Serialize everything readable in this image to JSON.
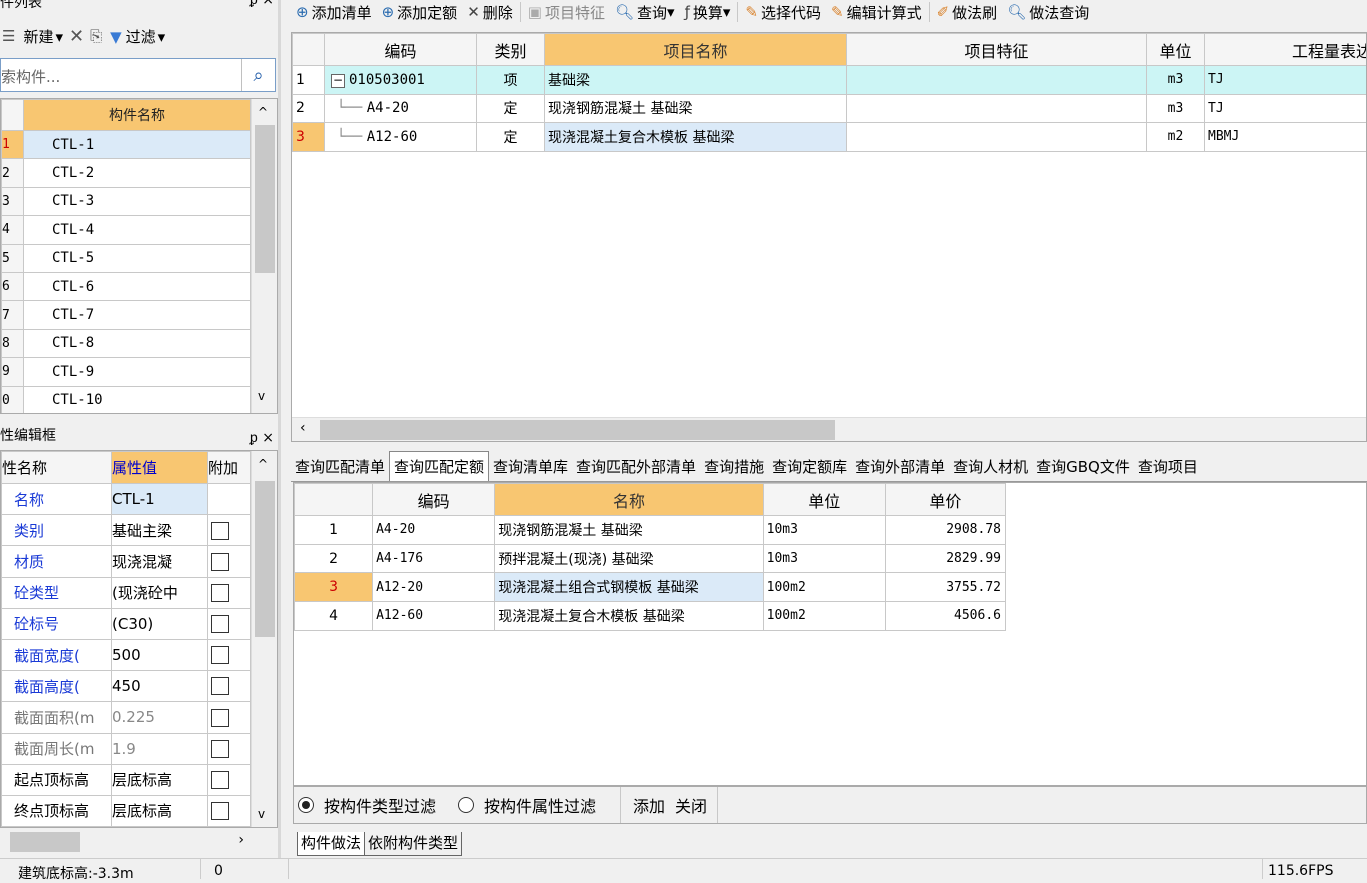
{
  "left_panel": {
    "component_list": {
      "title": "件列表",
      "toolbar": {
        "new_label": "新建",
        "filter_label": "过滤"
      },
      "search_placeholder": "索构件...",
      "header": "构件名称",
      "rows": [
        {
          "num": "1",
          "name": "CTL-1"
        },
        {
          "num": "2",
          "name": "CTL-2"
        },
        {
          "num": "3",
          "name": "CTL-3"
        },
        {
          "num": "4",
          "name": "CTL-4"
        },
        {
          "num": "5",
          "name": "CTL-5"
        },
        {
          "num": "6",
          "name": "CTL-6"
        },
        {
          "num": "7",
          "name": "CTL-7"
        },
        {
          "num": "8",
          "name": "CTL-8"
        },
        {
          "num": "9",
          "name": "CTL-9"
        },
        {
          "num": "0",
          "name": "CTL-10"
        }
      ]
    },
    "property_editor": {
      "title": "性编辑框",
      "headers": [
        "性名称",
        "属性值",
        "附加"
      ],
      "rows": [
        {
          "name": "名称",
          "value": "CTL-1",
          "has_check": false,
          "name_color": "blue"
        },
        {
          "name": "类别",
          "value": "基础主梁",
          "has_check": true,
          "name_color": "blue"
        },
        {
          "name": "材质",
          "value": "现浇混凝",
          "has_check": true,
          "name_color": "blue"
        },
        {
          "name": "砼类型",
          "value": "(现浇砼中",
          "has_check": true,
          "name_color": "blue"
        },
        {
          "name": "砼标号",
          "value": "(C30)",
          "has_check": true,
          "name_color": "blue"
        },
        {
          "name": "截面宽度(",
          "value": "500",
          "has_check": true,
          "name_color": "blue"
        },
        {
          "name": "截面高度(",
          "value": "450",
          "has_check": true,
          "name_color": "blue"
        },
        {
          "name": "截面面积(m",
          "value": "0.225",
          "has_check": true,
          "name_color": "gray"
        },
        {
          "name": "截面周长(m",
          "value": "1.9",
          "has_check": true,
          "name_color": "gray"
        },
        {
          "name": "起点顶标高",
          "value": "层底标高",
          "has_check": true,
          "name_color": "black"
        },
        {
          "name": "终点顶标高",
          "value": "层底标高",
          "has_check": true,
          "name_color": "black"
        }
      ]
    }
  },
  "main_toolbar": {
    "items": [
      "添加清单",
      "添加定额",
      "删除",
      "项目特征",
      "查询",
      "换算",
      "选择代码",
      "编辑计算式",
      "做法刷",
      "做法查询"
    ]
  },
  "upper_grid": {
    "headers": [
      "编码",
      "类别",
      "项目名称",
      "项目特征",
      "单位",
      "工程量表达式"
    ],
    "rows": [
      {
        "num": "1",
        "code": "010503001",
        "type": "项",
        "name": "基础梁",
        "feature": "",
        "unit": "m3",
        "expr": "TJ"
      },
      {
        "num": "2",
        "code": "A4-20",
        "type": "定",
        "name": "现浇钢筋混凝土 基础梁",
        "feature": "",
        "unit": "m3",
        "expr": "TJ"
      },
      {
        "num": "3",
        "code": "A12-60",
        "type": "定",
        "name": "现浇混凝土复合木模板 基础梁",
        "feature": "",
        "unit": "m2",
        "expr": "MBMJ"
      }
    ]
  },
  "query_tabs": [
    "查询匹配清单",
    "查询匹配定额",
    "查询清单库",
    "查询匹配外部清单",
    "查询措施",
    "查询定额库",
    "查询外部清单",
    "查询人材机",
    "查询GBQ文件",
    "查询项目"
  ],
  "lower_grid": {
    "headers": [
      "编码",
      "名称",
      "单位",
      "单价"
    ],
    "rows": [
      {
        "num": "1",
        "code": "A4-20",
        "name": "现浇钢筋混凝土 基础梁",
        "unit": "10m3",
        "price": "2908.78"
      },
      {
        "num": "2",
        "code": "A4-176",
        "name": "预拌混凝土(现浇) 基础梁",
        "unit": "10m3",
        "price": "2829.99"
      },
      {
        "num": "3",
        "code": "A12-20",
        "name": "现浇混凝土组合式钢模板 基础梁",
        "unit": "100m2",
        "price": "3755.72"
      },
      {
        "num": "4",
        "code": "A12-60",
        "name": "现浇混凝土复合木模板 基础梁",
        "unit": "100m2",
        "price": "4506.6"
      }
    ]
  },
  "filter_bar": {
    "option1": "按构件类型过滤",
    "option2": "按构件属性过滤",
    "add": "添加",
    "close": "关闭"
  },
  "bottom_tabs": [
    "构件做法",
    "依附构件类型"
  ],
  "status_bar": {
    "left": "建筑底标高:-3.3m",
    "num": "0",
    "fps": "115.6FPS"
  }
}
